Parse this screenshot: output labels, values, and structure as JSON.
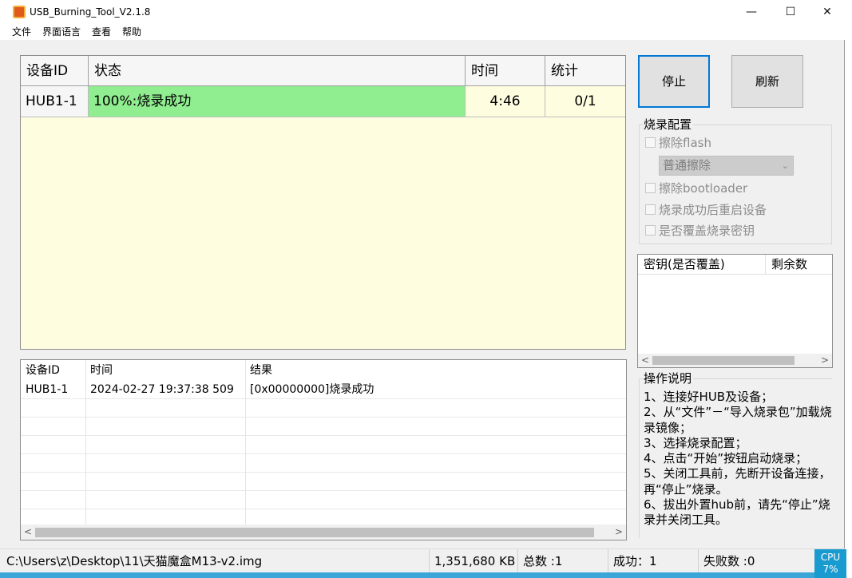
{
  "window": {
    "title": "USB_Burning_Tool_V2.1.8",
    "minimize": "—",
    "maximize": "☐",
    "close": "✕"
  },
  "menu": [
    "文件",
    "界面语言",
    "查看",
    "帮助"
  ],
  "device_table": {
    "columns": [
      "设备ID",
      "状态",
      "时间",
      "统计"
    ],
    "rows": [
      {
        "id": "HUB1-1",
        "status": "100%:烧录成功",
        "time": "4:46",
        "count": "0/1"
      }
    ],
    "colors": {
      "status_success": "#90ee90",
      "background": "#fffde0"
    }
  },
  "log_table": {
    "columns": [
      "设备ID",
      "时间",
      "结果"
    ],
    "rows": [
      {
        "id": "HUB1-1",
        "time": "2024-02-27 19:37:38 509",
        "result": "[0x00000000]烧录成功"
      }
    ]
  },
  "buttons": {
    "stop": "停止",
    "refresh": "刷新"
  },
  "burn_config": {
    "title": "烧录配置",
    "erase_flash": "擦除flash",
    "erase_mode": "普通擦除",
    "erase_bootloader": "擦除bootloader",
    "reboot_after": "烧录成功后重启设备",
    "overwrite_key": "是否覆盖烧录密钥"
  },
  "key_table": {
    "columns": [
      "密钥(是否覆盖)",
      "剩余数"
    ]
  },
  "instructions": {
    "title": "操作说明",
    "lines": [
      "1、连接好HUB及设备；",
      "2、从“文件”－“导入烧录包”加载烧录镜像；",
      "3、选择烧录配置；",
      "4、点击“开始”按钮启动烧录；",
      "5、关闭工具前，先断开设备连接，再“停止”烧录。",
      "6、拔出外置hub前，请先“停止”烧录并关闭工具。"
    ]
  },
  "status_bar": {
    "path": "C:\\Users\\z\\Desktop\\11\\天猫魔盒M13-v2.img",
    "size": "1,351,680 KB",
    "total": "总数 :1",
    "success": "成功：1",
    "fail": "失败数 :0"
  },
  "cpu": {
    "label": "CPU",
    "value": "7%"
  }
}
